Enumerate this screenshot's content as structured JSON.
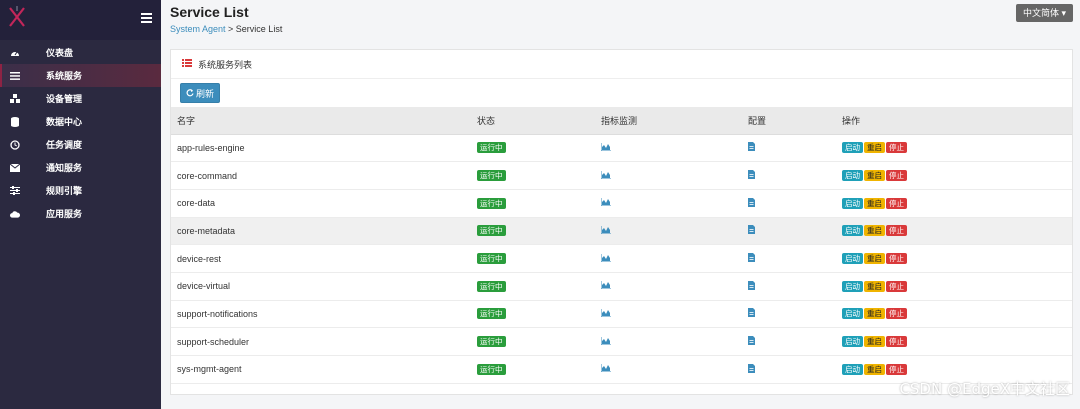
{
  "sidebar": {
    "items": [
      {
        "label": "仪表盘",
        "icon": "dashboard-icon"
      },
      {
        "label": "系统服务",
        "icon": "list-icon"
      },
      {
        "label": "设备管理",
        "icon": "cubes-icon"
      },
      {
        "label": "数据中心",
        "icon": "database-icon"
      },
      {
        "label": "任务调度",
        "icon": "clock-icon"
      },
      {
        "label": "通知服务",
        "icon": "envelope-icon"
      },
      {
        "label": "规则引擎",
        "icon": "sliders-icon"
      },
      {
        "label": "应用服务",
        "icon": "cloud-icon"
      }
    ]
  },
  "header": {
    "title": "Service List",
    "breadcrumb_link": "System Agent",
    "breadcrumb_sep": " > ",
    "breadcrumb_current": "Service List",
    "lang_label": "中文简体"
  },
  "panel": {
    "title": "系统服务列表",
    "refresh_label": "刷新",
    "columns": [
      "名字",
      "状态",
      "指标监测",
      "配置",
      "操作"
    ],
    "rows": [
      {
        "name": "app-rules-engine",
        "status": "运行中"
      },
      {
        "name": "core-command",
        "status": "运行中"
      },
      {
        "name": "core-data",
        "status": "运行中"
      },
      {
        "name": "core-metadata",
        "status": "运行中"
      },
      {
        "name": "device-rest",
        "status": "运行中"
      },
      {
        "name": "device-virtual",
        "status": "运行中"
      },
      {
        "name": "support-notifications",
        "status": "运行中"
      },
      {
        "name": "support-scheduler",
        "status": "运行中"
      },
      {
        "name": "sys-mgmt-agent",
        "status": "运行中"
      }
    ],
    "actions": {
      "start": "启动",
      "restart": "重启",
      "stop": "停止"
    }
  },
  "watermark": "CSDN @EdgeX中文社区",
  "colors": {
    "accent": "#3c8dbc",
    "sidebar": "#2b2940",
    "running": "#2a9d3c",
    "start": "#1fa0b8",
    "restart": "#f0b400",
    "stop": "#d9393a"
  }
}
